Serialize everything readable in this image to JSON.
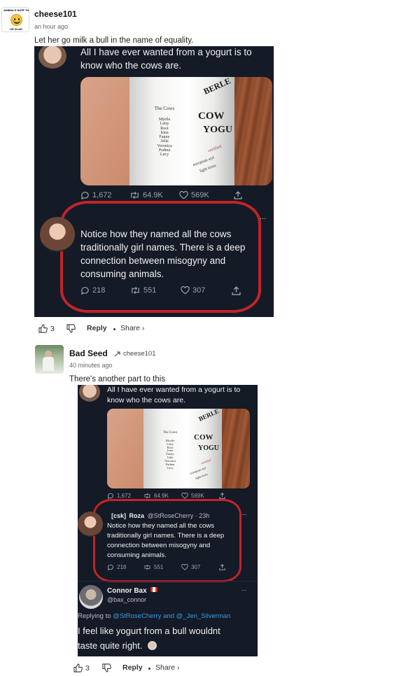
{
  "comment1": {
    "avatar_badge_top": "ANIMALS HATE THE",
    "avatar_badge_bottom": "I'M GLAD",
    "username": "cheese101",
    "time": "an hour ago",
    "text": "Let her go milk a bull in the name of equality.",
    "likes": "3",
    "reply_label": "Reply",
    "share_label": "Share ›"
  },
  "tweet_a": {
    "line1": "All I have ever wanted from a yogurt is to",
    "line2": "know who the cows are.",
    "cups_heading": "The Cows",
    "cow_names": [
      "Myrtle",
      "Letty",
      "Root",
      "Irma",
      "Fanny",
      "Julia",
      "Veronica",
      "Padma",
      "Lucy"
    ],
    "brand_top": "BERLE",
    "brand_mid": "COW",
    "brand_low": "YOGU",
    "small_words": [
      "certified",
      "european styl",
      "light textu"
    ],
    "replies": "1,672",
    "retweets": "64.9K",
    "likes": "569K"
  },
  "tweet_b": {
    "line1": "Notice how they named all the cows",
    "line2": "traditionally girl names. There is a deep",
    "line3": "connection between misogyny and",
    "line4": "consuming animals.",
    "replies": "218",
    "retweets": "551",
    "likes": "307",
    "more": "..."
  },
  "comment2": {
    "username": "Bad Seed",
    "reply_target": "cheese101",
    "time": "40 minutes ago",
    "text": "There's another part to this",
    "likes": "3",
    "reply_label": "Reply",
    "share_label": "Share ›"
  },
  "tweet_c": {
    "author_tag": "[csk]",
    "author": "Roza",
    "handle": "@StRoseCherry · 23h",
    "more": "...",
    "line1": "Notice how they named all the cows",
    "line2": "traditionally girl names. There is a deep",
    "line3": "connection between misogyny and",
    "line4": "consuming animals.",
    "replies": "218",
    "retweets": "551",
    "likes": "307"
  },
  "tweet_d": {
    "author": "Connor Bax",
    "handle": "@bax_connor",
    "more": "...",
    "replying_prefix": "Replying to",
    "replying_targets": "@StRoseCherry and @_Jen_Silverman",
    "line1": "I feel like yogurt from a bull wouldnt",
    "line2": "taste quite right."
  }
}
